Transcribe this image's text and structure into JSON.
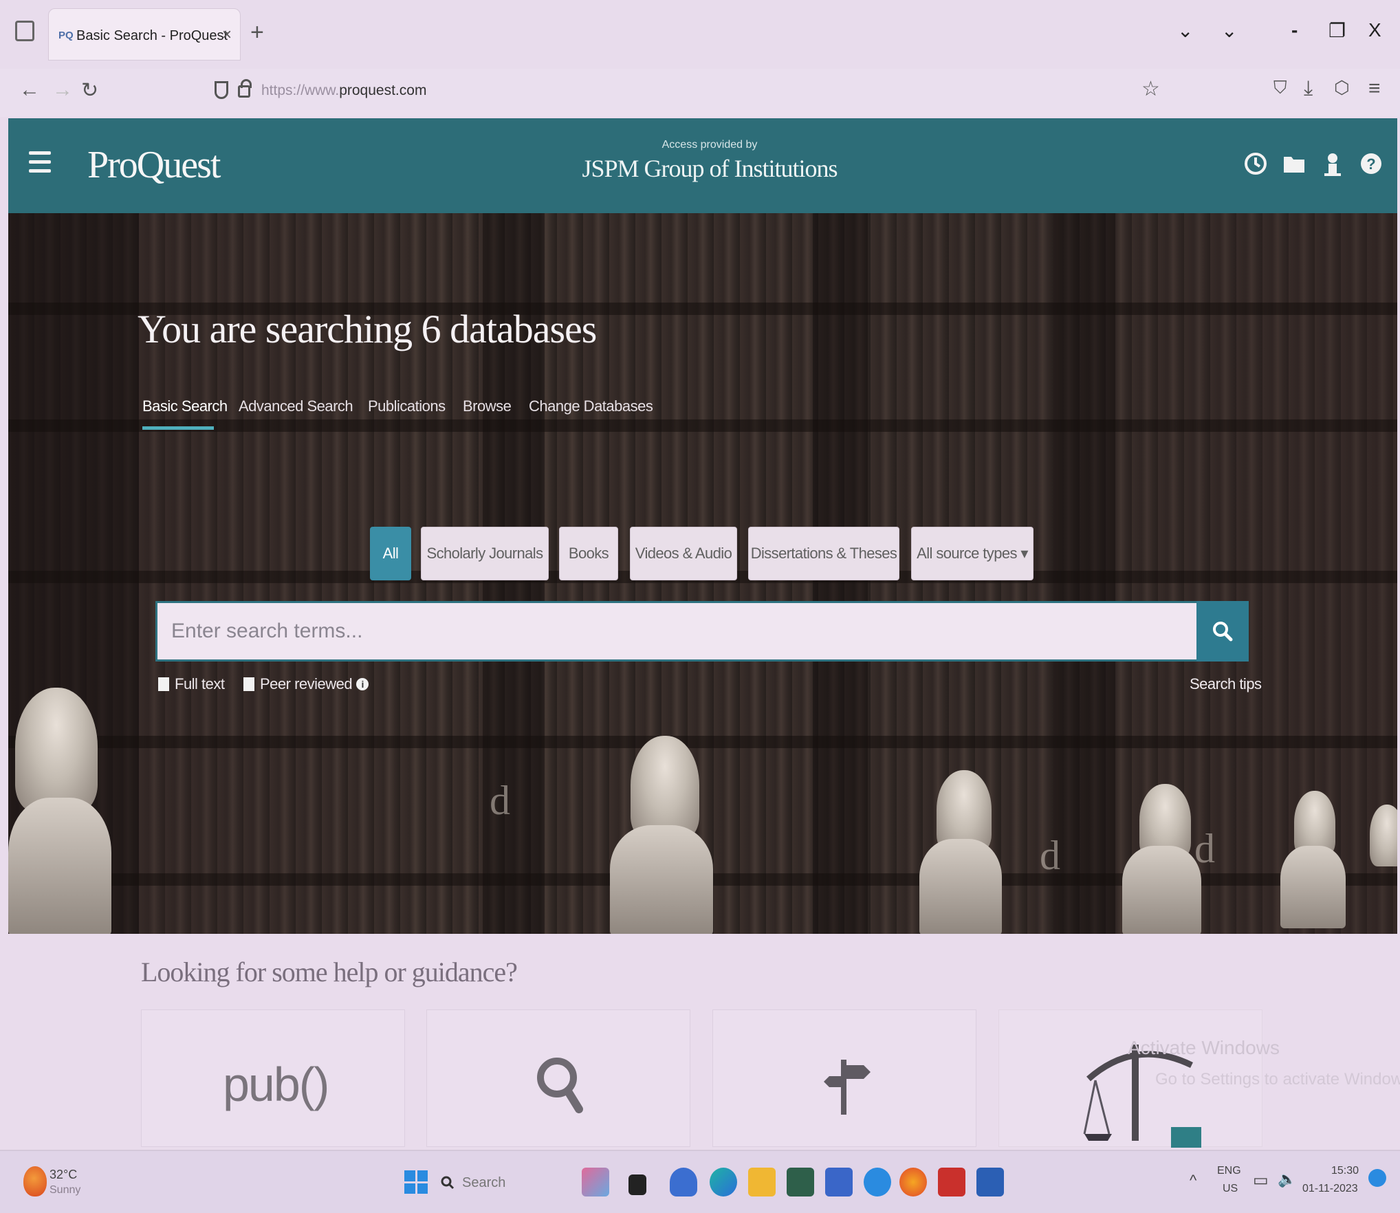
{
  "browser": {
    "tab_title": "Basic Search - ProQuest",
    "tab_favicon": "PQ",
    "url_prefix": "https://www.",
    "url_domain": "proquest.com",
    "window_controls": {
      "minimize": "-",
      "maximize": "❐",
      "close": "X"
    }
  },
  "header": {
    "logo": "ProQuest",
    "access_label": "Access provided by",
    "institution": "JSPM Group of Institutions",
    "icons": [
      "history-icon",
      "folder-icon",
      "user-icon",
      "help-icon"
    ]
  },
  "hero": {
    "title": "You are searching 6 databases",
    "tabs": [
      "Basic Search",
      "Advanced Search",
      "Publications",
      "Browse",
      "Change Databases"
    ],
    "active_tab": "Basic Search",
    "filters": [
      "All",
      "Scholarly Journals",
      "Books",
      "Videos & Audio",
      "Dissertations & Theses",
      "All source types ▾"
    ],
    "active_filter": "All",
    "search_placeholder": "Enter search terms...",
    "fulltext_label": "Full text",
    "peer_label": "Peer reviewed",
    "info_glyph": "i",
    "search_tips": "Search tips"
  },
  "help": {
    "title": "Looking for some help or guidance?",
    "cards": [
      {
        "icon": "pub-icon",
        "text": "pub()"
      },
      {
        "icon": "magnifier-icon",
        "text": ""
      },
      {
        "icon": "signpost-icon",
        "text": ""
      },
      {
        "icon": "scales-icon",
        "text": ""
      }
    ],
    "watermark_line1": "Activate Windows",
    "watermark_line2": "Go to Settings to activate Windows."
  },
  "taskbar": {
    "weather_temp": "32°C",
    "weather_desc": "Sunny",
    "search_label": "Search",
    "lang_top": "ENG",
    "lang_bottom": "US",
    "time": "15:30",
    "date": "01-11-2023"
  },
  "colors": {
    "header_teal": "#2d6d78",
    "accent_blue": "#3a8ea6",
    "tab_underline": "#4fb0bd"
  }
}
